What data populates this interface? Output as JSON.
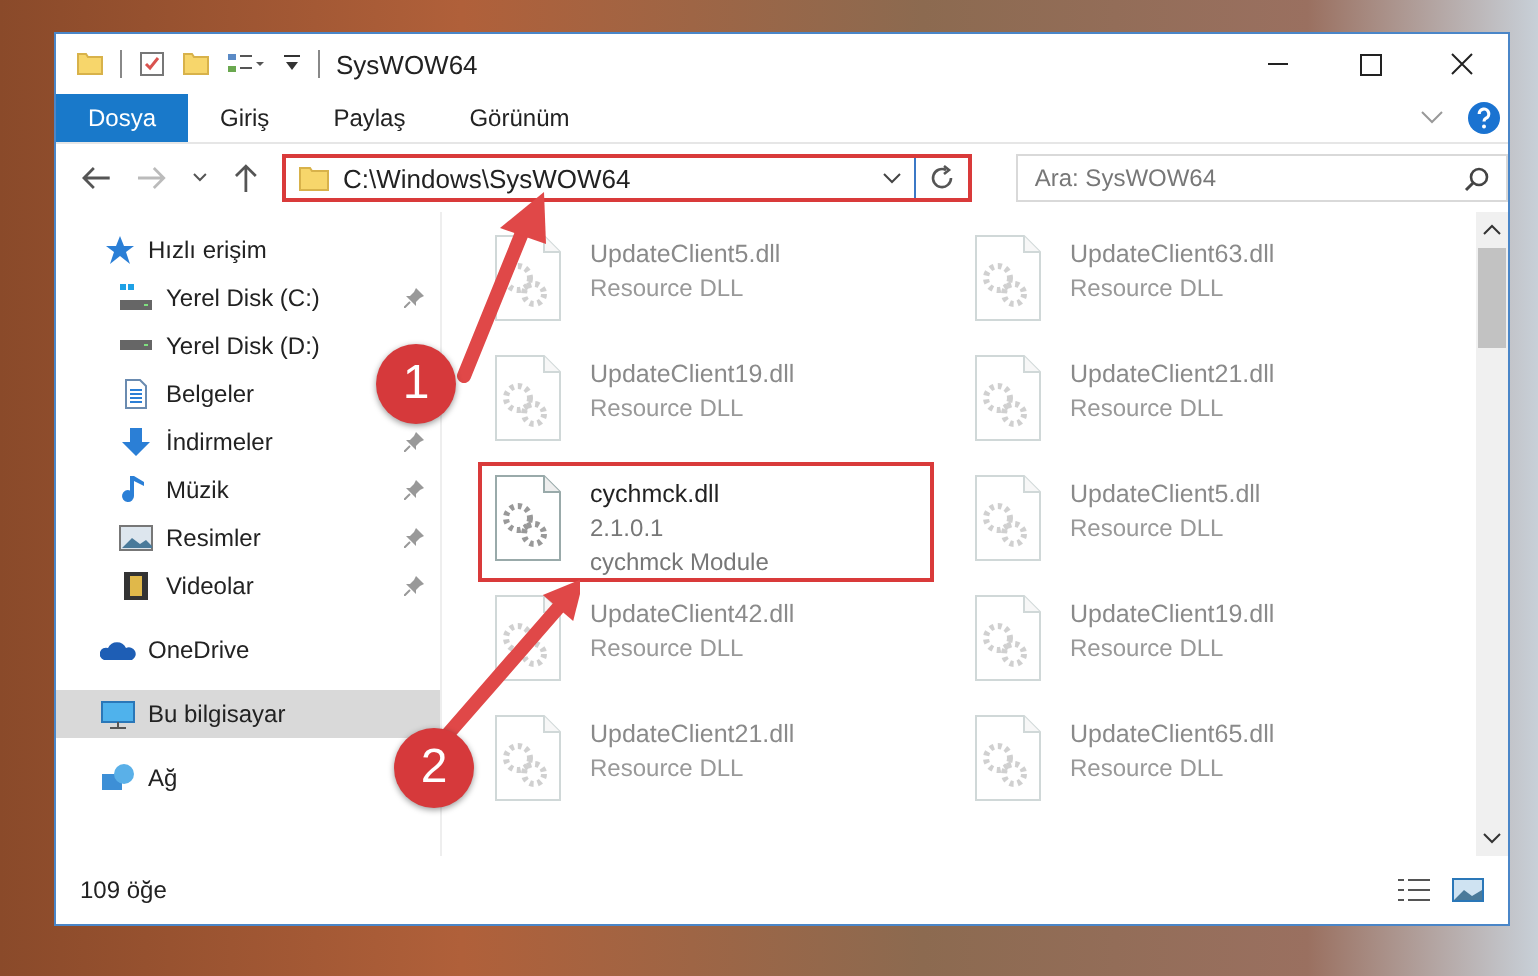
{
  "window": {
    "title": "SysWOW64"
  },
  "ribbon": {
    "tabs": [
      {
        "label": "Dosya",
        "selected": true
      },
      {
        "label": "Giriş",
        "selected": false
      },
      {
        "label": "Paylaş",
        "selected": false
      },
      {
        "label": "Görünüm",
        "selected": false
      }
    ]
  },
  "address": {
    "path": "C:\\Windows\\SysWOW64",
    "highlighted": true
  },
  "search": {
    "placeholder": "Ara: SysWOW64"
  },
  "sidebar": {
    "items": [
      {
        "label": "Hızlı erişim",
        "kind": "star",
        "selected": false,
        "children": [
          {
            "label": "Yerel Disk (C:)",
            "kind": "drive-c",
            "pinned": true
          },
          {
            "label": "Yerel Disk (D:)",
            "kind": "drive",
            "pinned": false
          },
          {
            "label": "Belgeler",
            "kind": "document",
            "pinned": false
          },
          {
            "label": "İndirmeler",
            "kind": "download",
            "pinned": true
          },
          {
            "label": "Müzik",
            "kind": "music",
            "pinned": true
          },
          {
            "label": "Resimler",
            "kind": "picture",
            "pinned": true
          },
          {
            "label": "Videolar",
            "kind": "video",
            "pinned": true
          }
        ]
      },
      {
        "label": "OneDrive",
        "kind": "cloud",
        "selected": false
      },
      {
        "label": "Bu bilgisayar",
        "kind": "computer",
        "selected": true
      },
      {
        "label": "Ağ",
        "kind": "network",
        "selected": false
      }
    ]
  },
  "files": {
    "items": [
      {
        "name": "UpdateClient5.dll",
        "details": [
          "Resource DLL"
        ],
        "dimmed": true,
        "highlighted": false
      },
      {
        "name": "UpdateClient63.dll",
        "details": [
          "Resource DLL"
        ],
        "dimmed": true,
        "highlighted": false
      },
      {
        "name": "UpdateClient19.dll",
        "details": [
          "Resource DLL"
        ],
        "dimmed": true,
        "highlighted": false
      },
      {
        "name": "UpdateClient21.dll",
        "details": [
          "Resource DLL"
        ],
        "dimmed": true,
        "highlighted": false
      },
      {
        "name": "cychmck.dll",
        "details": [
          "2.1.0.1",
          "cychmck Module"
        ],
        "dimmed": false,
        "highlighted": true
      },
      {
        "name": "UpdateClient5.dll",
        "details": [
          "Resource DLL"
        ],
        "dimmed": true,
        "highlighted": false
      },
      {
        "name": "UpdateClient42.dll",
        "details": [
          "Resource DLL"
        ],
        "dimmed": true,
        "highlighted": false
      },
      {
        "name": "UpdateClient19.dll",
        "details": [
          "Resource DLL"
        ],
        "dimmed": true,
        "highlighted": false
      },
      {
        "name": "UpdateClient21.dll",
        "details": [
          "Resource DLL"
        ],
        "dimmed": true,
        "highlighted": false
      },
      {
        "name": "UpdateClient65.dll",
        "details": [
          "Resource DLL"
        ],
        "dimmed": true,
        "highlighted": false
      }
    ]
  },
  "status_bar": {
    "count": "109 öğe"
  },
  "annotations": [
    {
      "label": "1"
    },
    {
      "label": "2"
    }
  ]
}
